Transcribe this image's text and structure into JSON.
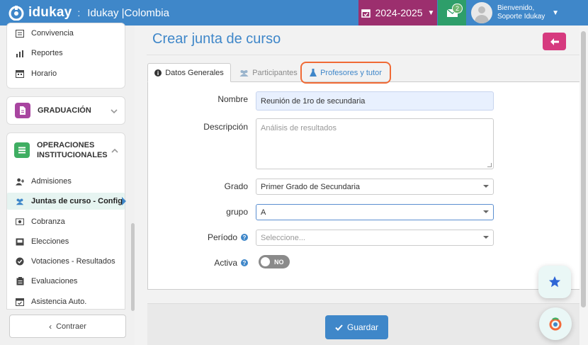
{
  "header": {
    "brand": "idukay",
    "separator": ":",
    "org": "Idukay |Colombia",
    "year": "2024-2025",
    "mail_count": "2",
    "welcome": "Bienvenido,",
    "user": "Soporte Idukay"
  },
  "sidebar": {
    "top_items": [
      {
        "label": "Convivencia",
        "icon": "list-icon"
      },
      {
        "label": "Reportes",
        "icon": "bar-chart-icon"
      },
      {
        "label": "Horario",
        "icon": "calendar-icon"
      }
    ],
    "sections": [
      {
        "label": "GRADUACIÓN",
        "color": "#a845a0"
      },
      {
        "label_line1": "OPERACIONES",
        "label_line2": "INSTITUCIONALES",
        "color": "#3fae62"
      }
    ],
    "items": [
      {
        "label": "Admisiones",
        "icon": "user-plus-icon"
      },
      {
        "label": "Juntas de curso - Config",
        "icon": "users-icon"
      },
      {
        "label": "Cobranza",
        "icon": "money-icon"
      },
      {
        "label": "Elecciones",
        "icon": "inbox-icon"
      },
      {
        "label": "Votaciones - Resultados",
        "icon": "check-circle-icon"
      },
      {
        "label": "Evaluaciones",
        "icon": "clipboard-icon"
      },
      {
        "label": "Asistencia Auto.",
        "icon": "calendar-check-icon"
      }
    ],
    "collapse_label": "Contraer"
  },
  "page": {
    "title": "Crear junta de curso",
    "tabs": [
      {
        "label": "Datos Generales"
      },
      {
        "label": "Participantes"
      },
      {
        "label": "Profesores y tutor"
      }
    ],
    "form": {
      "nombre_label": "Nombre",
      "nombre_value": "Reunión de 1ro de secundaria",
      "descripcion_label": "Descripción",
      "descripcion_value": "Análisis de resultados",
      "grado_label": "Grado",
      "grado_value": "Primer Grado de Secundaria",
      "grupo_label": "grupo",
      "grupo_value": "A",
      "periodo_label": "Período",
      "periodo_placeholder": "Seleccione...",
      "activa_label": "Activa",
      "activa_state": "NO"
    },
    "save_label": "Guardar"
  },
  "colors": {
    "primary": "#3f87c9",
    "year_bg": "#9c2f6e",
    "mail_bg": "#2e9e6a",
    "back_btn": "#d63a7f",
    "tab_highlight": "#f06a35"
  }
}
